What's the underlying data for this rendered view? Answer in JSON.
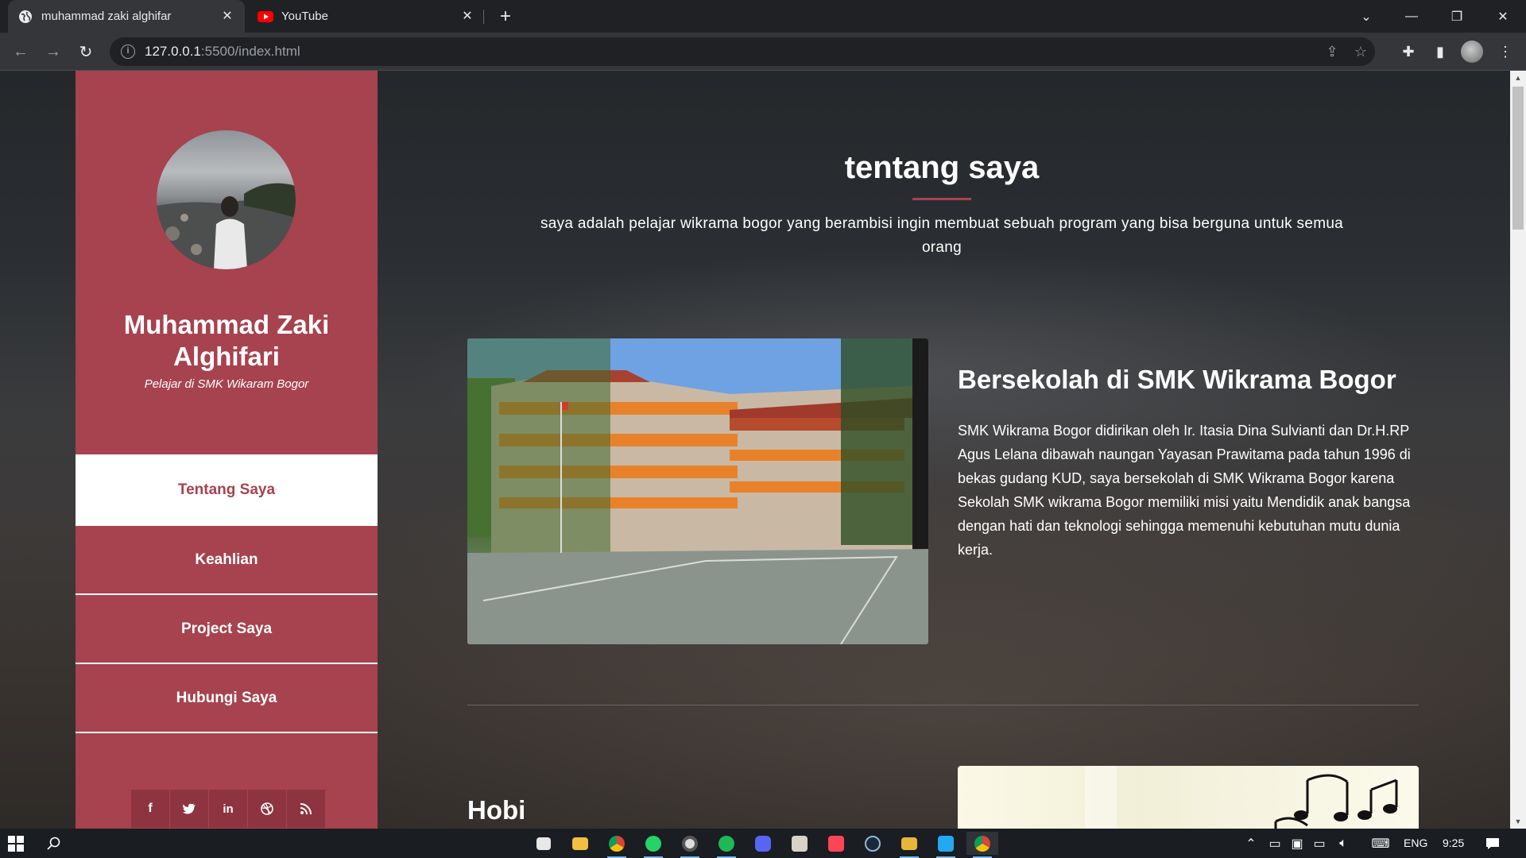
{
  "browser": {
    "tabs": [
      {
        "title": "muhammad zaki alghifar",
        "active": true,
        "icon": "globe-icon"
      },
      {
        "title": "YouTube",
        "active": false,
        "icon": "youtube-icon"
      }
    ],
    "new_tab_label": "+",
    "address": {
      "host": "127.0.0.1",
      "path": ":5500/index.html"
    }
  },
  "sidebar": {
    "name": "Muhammad Zaki Alghifari",
    "subtitle": "Pelajar di SMK Wikaram Bogor",
    "nav": [
      {
        "label": "Tentang Saya",
        "active": true
      },
      {
        "label": "Keahlian",
        "active": false
      },
      {
        "label": "Project Saya",
        "active": false
      },
      {
        "label": "Hubungi Saya",
        "active": false
      }
    ],
    "socials": [
      {
        "icon": "facebook-icon",
        "glyph": "f"
      },
      {
        "icon": "twitter-icon",
        "glyph": "t"
      },
      {
        "icon": "linkedin-icon",
        "glyph": "in"
      },
      {
        "icon": "dribbble-icon",
        "glyph": "◎"
      },
      {
        "icon": "rss-icon",
        "glyph": "))"
      }
    ],
    "accent_color": "#a7424f"
  },
  "about": {
    "title": "tentang saya",
    "description": "saya adalah pelajar wikrama bogor yang berambisi ingin membuat sebuah program yang bisa berguna untuk semua orang"
  },
  "school": {
    "heading": "Bersekolah di SMK Wikrama Bogor",
    "text": "SMK Wikrama Bogor didirikan oleh Ir. Itasia Dina Sulvianti dan Dr.H.RP Agus Lelana dibawah naungan Yayasan Prawitama pada tahun 1996 di bekas gudang KUD, saya bersekolah di SMK Wikrama Bogor karena Sekolah SMK wikrama Bogor memiliki misi yaitu Mendidik anak bangsa dengan hati dan teknologi sehingga memenuhi kebutuhan mutu dunia kerja."
  },
  "hobby": {
    "heading": "Hobi"
  },
  "taskbar": {
    "lang": "ENG",
    "time": "9:25"
  }
}
